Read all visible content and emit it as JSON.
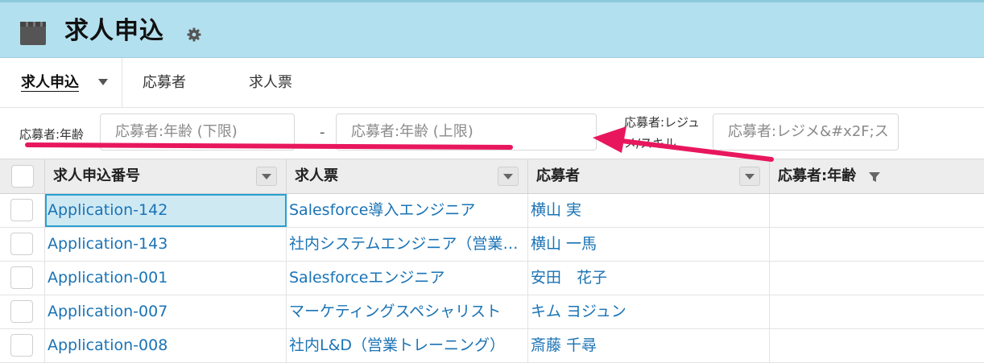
{
  "header": {
    "title": "求人申込",
    "bg_color": "#b3e0ee"
  },
  "tabs": [
    {
      "label": "求人申込",
      "active": true
    },
    {
      "label": "応募者",
      "active": false
    },
    {
      "label": "求人票",
      "active": false
    }
  ],
  "filters": {
    "age_label": "応募者:年齢",
    "age_min_placeholder": "応募者:年齢 (下限)",
    "range_separator": "-",
    "age_max_placeholder": "応募者:年齢 (上限)",
    "resume_label": "応募者:レジュメ/スキル",
    "resume_placeholder": "応募者:レジメ&#x2F;ス"
  },
  "table": {
    "columns": [
      "求人申込番号",
      "求人票",
      "応募者",
      "応募者:年齢"
    ],
    "rows": [
      {
        "application": "Application-142",
        "job": "Salesforce導入エンジニア",
        "applicant": "横山 実",
        "age": ""
      },
      {
        "application": "Application-143",
        "job": "社内システムエンジニア（営業支援）",
        "applicant": "横山 一馬",
        "age": ""
      },
      {
        "application": "Application-001",
        "job": "Salesforceエンジニア",
        "applicant": "安田　花子",
        "age": ""
      },
      {
        "application": "Application-007",
        "job": "マーケティングスペシャリスト",
        "applicant": "キム ヨジュン",
        "age": ""
      },
      {
        "application": "Application-008",
        "job": "社内L&D（営業トレーニング）",
        "applicant": "斎藤 千尋",
        "age": ""
      }
    ],
    "link_color": "#1a73b5",
    "selected_cell_color": "#cfe9f3"
  },
  "annotation_color": "#e8175d"
}
